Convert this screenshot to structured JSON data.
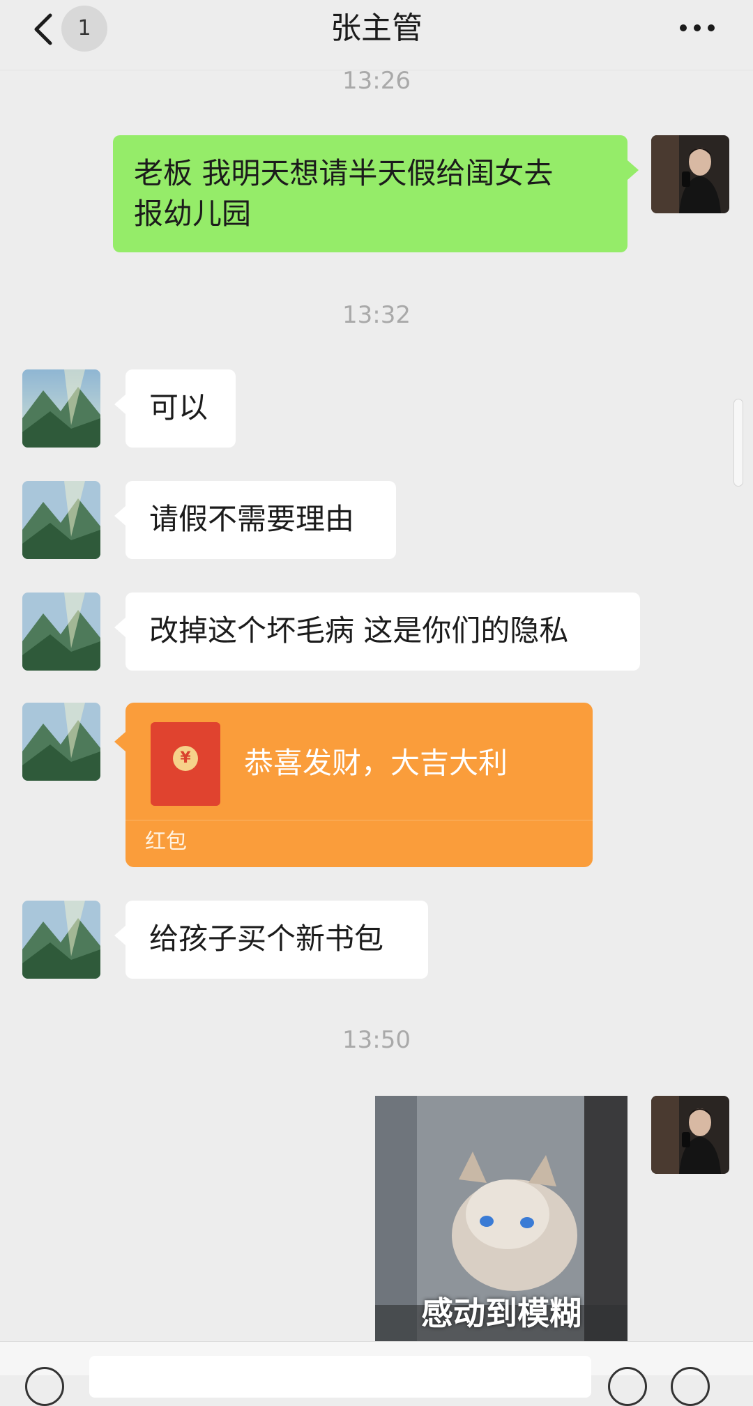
{
  "header": {
    "title": "张主管",
    "unread_badge": "1",
    "back_icon": "chevron-left-icon",
    "more_icon": "more-horizontal-icon"
  },
  "messages": {
    "time_1": "13:26",
    "msg_1": [
      "老板  我明天想请半天假给闺女去",
      "报幼儿园"
    ],
    "time_2": "13:32",
    "msg_2": "可以",
    "msg_3": "请假不需要理由",
    "msg_4": "改掉这个坏毛病  这是你们的隐私",
    "red_packet": {
      "wish": "恭喜发财，大吉大利",
      "label": "红包",
      "color": "#fa9d3b"
    },
    "msg_5": "给孩子买个新书包",
    "time_3": "13:50",
    "sticker_caption": "感动到模糊"
  },
  "colors": {
    "background": "#ededed",
    "sent_bubble": "#95ec69",
    "received_bubble": "#ffffff",
    "timestamp": "#a9a9a9"
  }
}
